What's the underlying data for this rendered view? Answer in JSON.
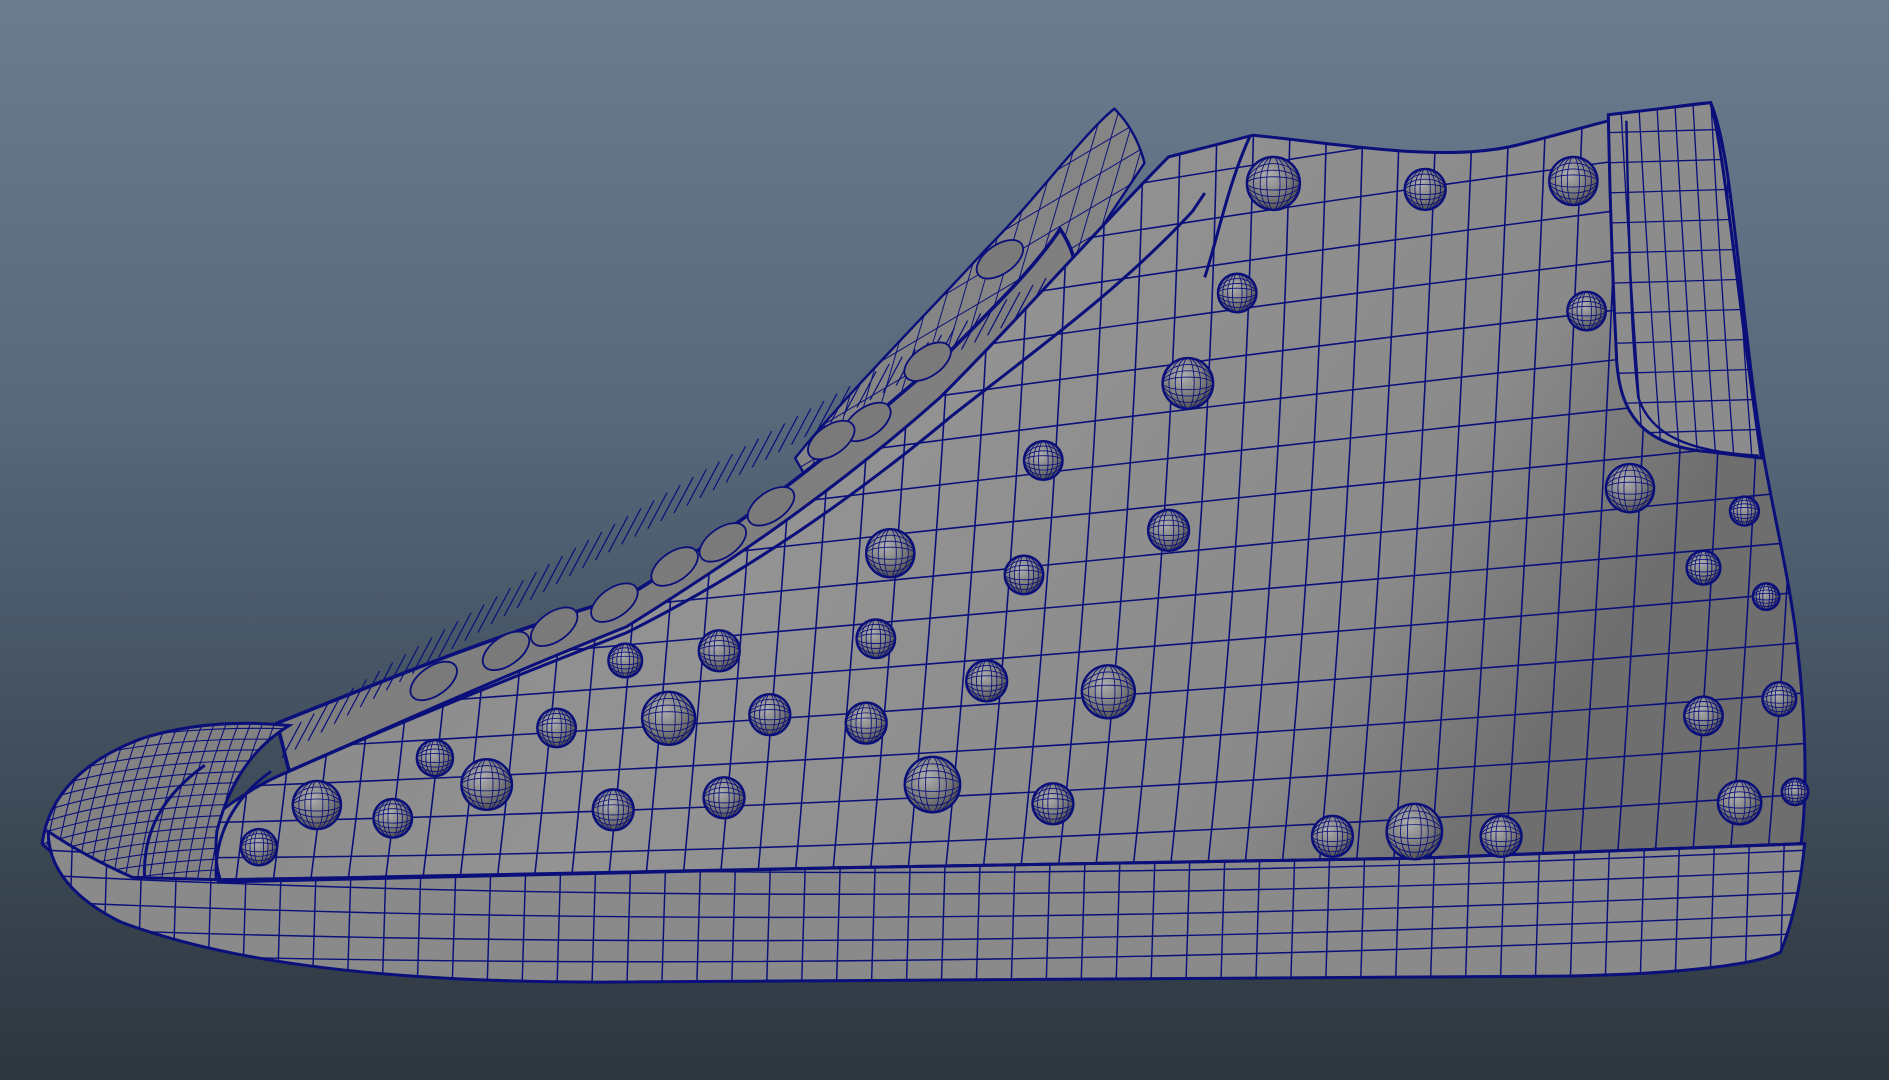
{
  "viewport": {
    "background_top": "#6b7c8f",
    "background_bottom": "#2d363f"
  },
  "model": {
    "shading": "wireframe-on-shaded",
    "surface_color": "#8a8a8a",
    "wire_color": "#0a0f7a",
    "object": "high-top-sneaker"
  }
}
